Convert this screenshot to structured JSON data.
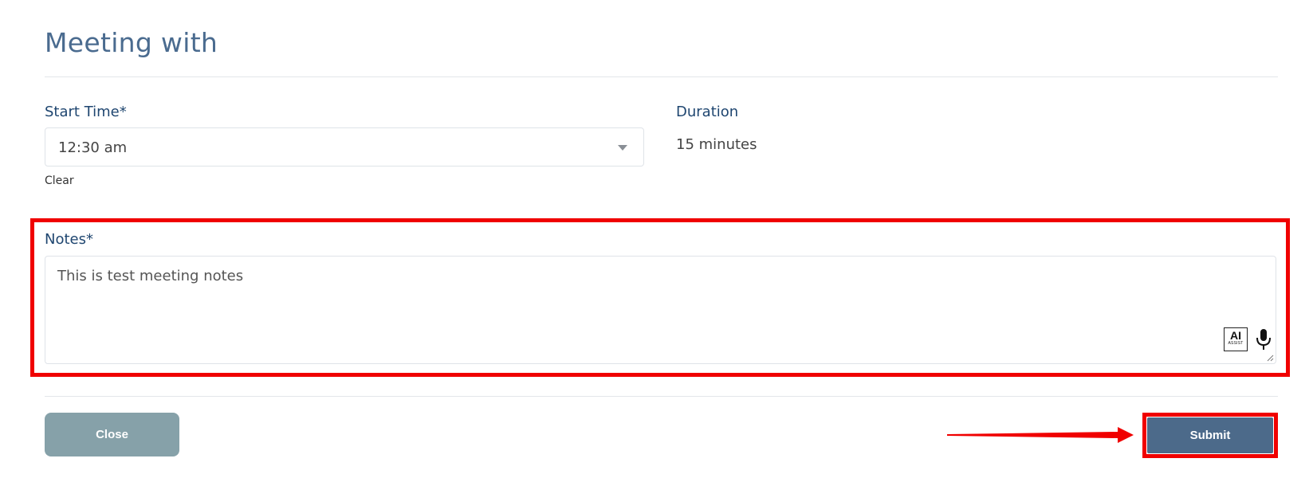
{
  "header": {
    "title": "Meeting with"
  },
  "form": {
    "start_time": {
      "label": "Start Time*",
      "value": "12:30 am",
      "clear_label": "Clear"
    },
    "duration": {
      "label": "Duration",
      "value": "15 minutes"
    },
    "notes": {
      "label": "Notes*",
      "value": "This is test meeting notes",
      "ai_assist": {
        "main": "AI",
        "sub": "ASSIST"
      }
    }
  },
  "footer": {
    "close_label": "Close",
    "submit_label": "Submit"
  },
  "colors": {
    "title": "#4a6b8f",
    "label": "#1f4670",
    "close_button": "#86a1a9",
    "submit_button": "#4c6a8a",
    "annotation": "#f00000"
  },
  "icons": {
    "select_caret": "chevron-down-icon",
    "microphone": "microphone-icon",
    "ai_assist": "ai-assist-icon",
    "resize": "resize-grip-icon",
    "annotation_arrow": "arrow-right-icon"
  }
}
